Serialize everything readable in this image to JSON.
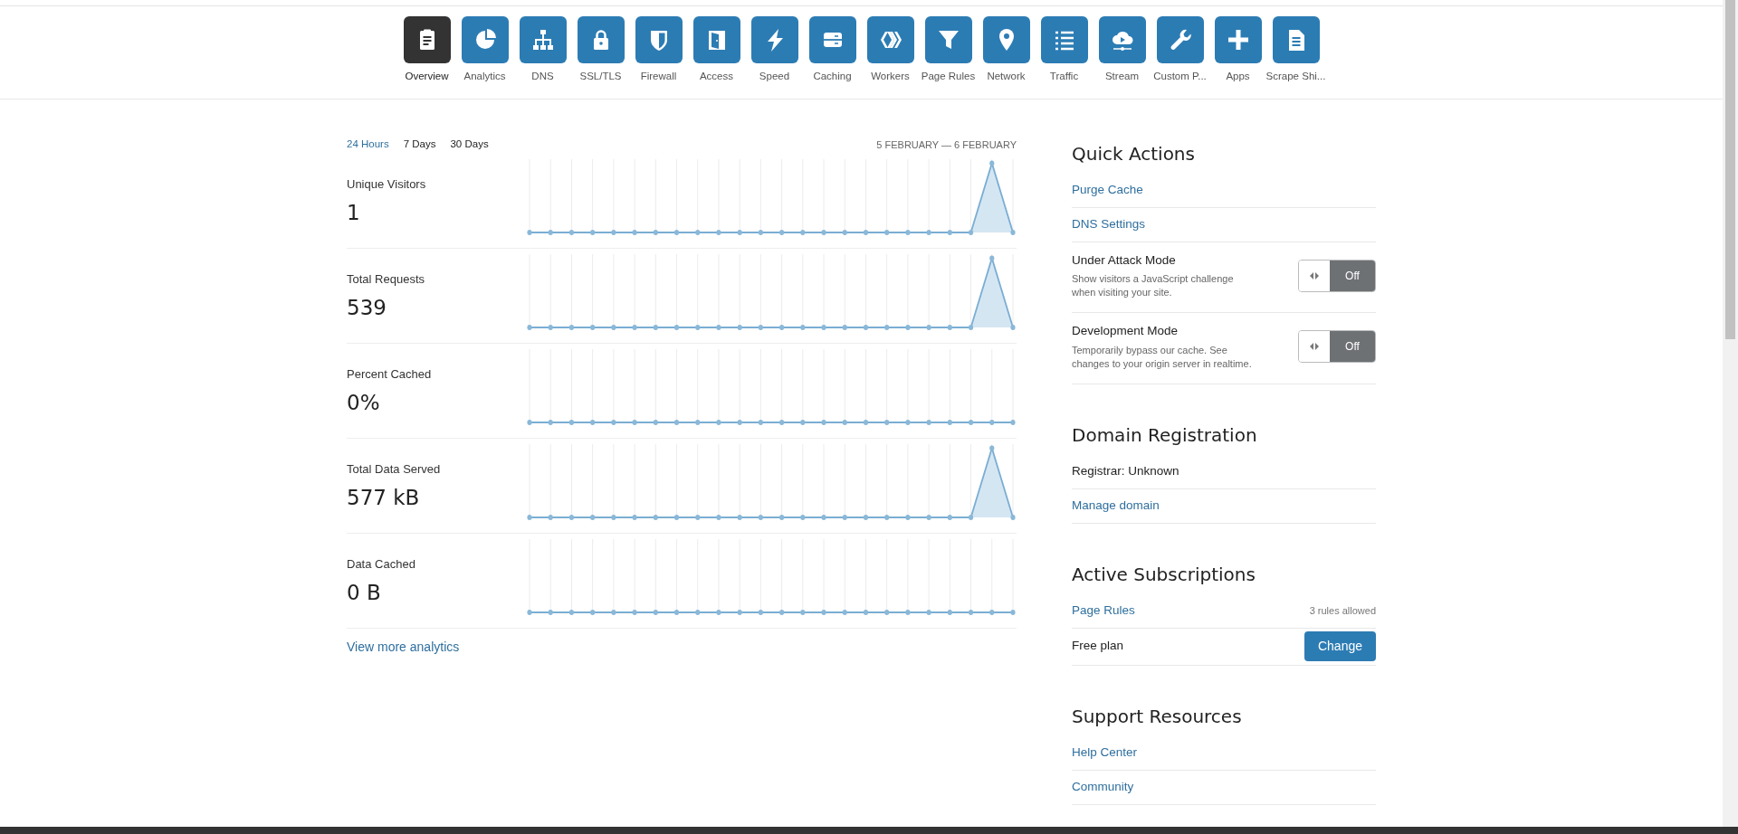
{
  "nav": [
    {
      "label": "Overview",
      "selected": true
    },
    {
      "label": "Analytics",
      "selected": false
    },
    {
      "label": "DNS",
      "selected": false
    },
    {
      "label": "SSL/TLS",
      "selected": false
    },
    {
      "label": "Firewall",
      "selected": false
    },
    {
      "label": "Access",
      "selected": false
    },
    {
      "label": "Speed",
      "selected": false
    },
    {
      "label": "Caching",
      "selected": false
    },
    {
      "label": "Workers",
      "selected": false
    },
    {
      "label": "Page Rules",
      "selected": false
    },
    {
      "label": "Network",
      "selected": false
    },
    {
      "label": "Traffic",
      "selected": false
    },
    {
      "label": "Stream",
      "selected": false
    },
    {
      "label": "Custom P...",
      "selected": false
    },
    {
      "label": "Apps",
      "selected": false
    },
    {
      "label": "Scrape Shi...",
      "selected": false
    }
  ],
  "ranges": [
    {
      "label": "24 Hours",
      "selected": true
    },
    {
      "label": "7 Days",
      "selected": false
    },
    {
      "label": "30 Days",
      "selected": false
    }
  ],
  "date_range": "5 FEBRUARY — 6 FEBRUARY",
  "stats": [
    {
      "label": "Unique Visitors",
      "value": "1",
      "kind": "peak"
    },
    {
      "label": "Total Requests",
      "value": "539",
      "kind": "peak"
    },
    {
      "label": "Percent Cached",
      "value": "0%",
      "kind": "flat"
    },
    {
      "label": "Total Data Served",
      "value": "577 kB",
      "kind": "peak"
    },
    {
      "label": "Data Cached",
      "value": "0 B",
      "kind": "flat"
    }
  ],
  "more_link": "View more analytics",
  "sections": [
    {
      "title": "Quick Actions",
      "rows": [
        {
          "kind": "link",
          "label": "Purge Cache"
        },
        {
          "kind": "link",
          "label": "DNS Settings"
        },
        {
          "kind": "toggle",
          "label": "Under Attack Mode",
          "description": "Show visitors a JavaScript challenge when visiting your site.",
          "on": false,
          "state": "Off"
        },
        {
          "kind": "toggle",
          "label": "Development Mode",
          "description": "Temporarily bypass our cache. See changes to your origin server in realtime.",
          "on": false,
          "state": "Off"
        }
      ]
    },
    {
      "title": "Domain Registration",
      "rows": [
        {
          "kind": "text",
          "label": "Registrar: Unknown"
        },
        {
          "kind": "link",
          "label": "Manage domain"
        }
      ]
    },
    {
      "title": "Active Subscriptions",
      "rows": [
        {
          "kind": "link",
          "label": "Page Rules",
          "note": "3 rules allowed"
        },
        {
          "kind": "button",
          "label": "Free plan",
          "button": "Change"
        }
      ]
    },
    {
      "title": "Support Resources",
      "rows": [
        {
          "kind": "link",
          "label": "Help Center"
        },
        {
          "kind": "link",
          "label": "Community"
        }
      ]
    }
  ]
}
